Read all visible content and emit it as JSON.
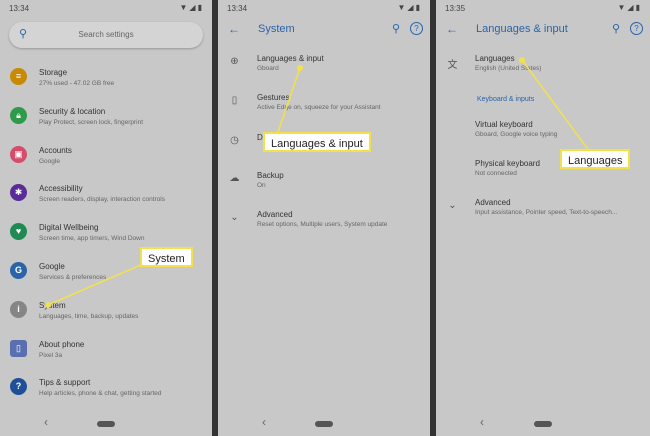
{
  "screen1": {
    "time": "13:34",
    "search_placeholder": "Search settings",
    "items": [
      {
        "title": "Storage",
        "subtitle": "27% used - 47.02 GB free",
        "color": "#c88a00",
        "icon": "storage-icon"
      },
      {
        "title": "Security & location",
        "subtitle": "Play Protect, screen lock, fingerprint",
        "color": "#2e9a4a",
        "icon": "lock-icon"
      },
      {
        "title": "Accounts",
        "subtitle": "Google",
        "color": "#d44d6a",
        "icon": "account-icon"
      },
      {
        "title": "Accessibility",
        "subtitle": "Screen readers, display, interaction controls",
        "color": "#5b2b9a",
        "icon": "accessibility-icon"
      },
      {
        "title": "Digital Wellbeing",
        "subtitle": "Screen time, app timers, Wind Down",
        "color": "#1f8a52",
        "icon": "wellbeing-icon"
      },
      {
        "title": "Google",
        "subtitle": "Services & preferences",
        "color": "#2a64a8",
        "icon": "google-icon"
      },
      {
        "title": "System",
        "subtitle": "Languages, time, backup, updates",
        "color": "#858585",
        "icon": "info-icon"
      },
      {
        "title": "About phone",
        "subtitle": "Pixel 3a",
        "color": "#5a6fb0",
        "icon": "phone-icon"
      },
      {
        "title": "Tips & support",
        "subtitle": "Help articles, phone & chat, getting started",
        "color": "#1f4f99",
        "icon": "help-icon"
      }
    ],
    "callout": "System"
  },
  "screen2": {
    "time": "13:34",
    "title": "System",
    "items": [
      {
        "title": "Languages & input",
        "subtitle": "Gboard",
        "icon": "globe-icon",
        "glyph": "🌐"
      },
      {
        "title": "Gestures",
        "subtitle": "Active Edge on, squeeze for your Assistant",
        "icon": "gesture-icon",
        "glyph": "▯"
      },
      {
        "title": "D",
        "subtitle": "",
        "icon": "clock-icon",
        "glyph": "◷"
      },
      {
        "title": "Backup",
        "subtitle": "On",
        "icon": "backup-icon",
        "glyph": "☁"
      },
      {
        "title": "Advanced",
        "subtitle": "Reset options, Multiple users, System update",
        "icon": "chevron-down-icon",
        "glyph": "⌄"
      }
    ],
    "callout": "Languages & input"
  },
  "screen3": {
    "time": "13:35",
    "title": "Languages & input",
    "languages_title": "Languages",
    "languages_subtitle": "English (United States)",
    "section_header": "Keyboard & inputs",
    "items": [
      {
        "title": "Virtual keyboard",
        "subtitle": "Gboard, Google voice typing"
      },
      {
        "title": "Physical keyboard",
        "subtitle": "Not connected"
      },
      {
        "title": "Advanced",
        "subtitle": "Input assistance, Pointer speed, Text-to-speech..."
      }
    ],
    "callout": "Languages"
  },
  "colors": {
    "accent": "#2a64a8",
    "callout_border": "#f3e14a",
    "background": "#c8c8c8"
  }
}
